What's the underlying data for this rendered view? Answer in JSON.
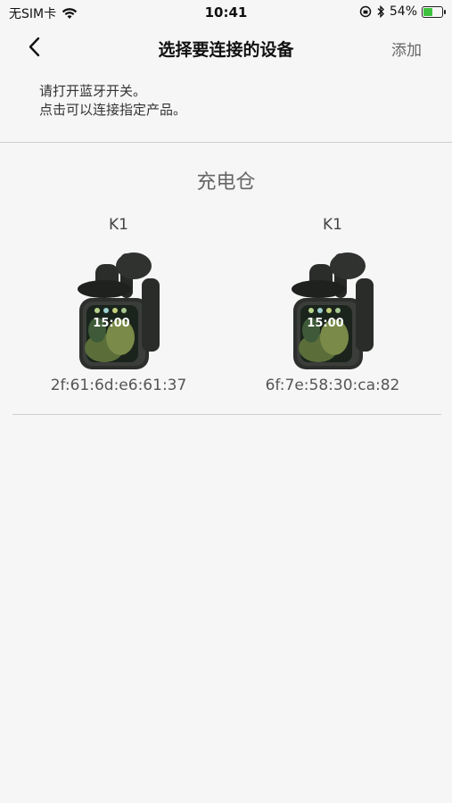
{
  "status": {
    "carrier": "无SIM卡",
    "time": "10:41",
    "battery_percent": "54%",
    "battery_level": 0.54,
    "icons": [
      "wifi-icon",
      "orientation-lock-icon",
      "bluetooth-icon",
      "battery-icon"
    ]
  },
  "nav": {
    "title": "选择要连接的设备",
    "add_label": "添加",
    "back_icon": "chevron-left-icon"
  },
  "hint": {
    "line1": "请打开蓝牙开关。",
    "line2": "点击可以连接指定产品。"
  },
  "section": {
    "title": "充电仓"
  },
  "devices": [
    {
      "name": "K1",
      "mac": "2f:61:6d:e6:61:37",
      "screen_time": "15:00"
    },
    {
      "name": "K1",
      "mac": "6f:7e:58:30:ca:82",
      "screen_time": "15:00"
    }
  ],
  "colors": {
    "background": "#f6f6f6",
    "divider": "#cfcfcf",
    "battery_fill": "#3ec23e"
  }
}
